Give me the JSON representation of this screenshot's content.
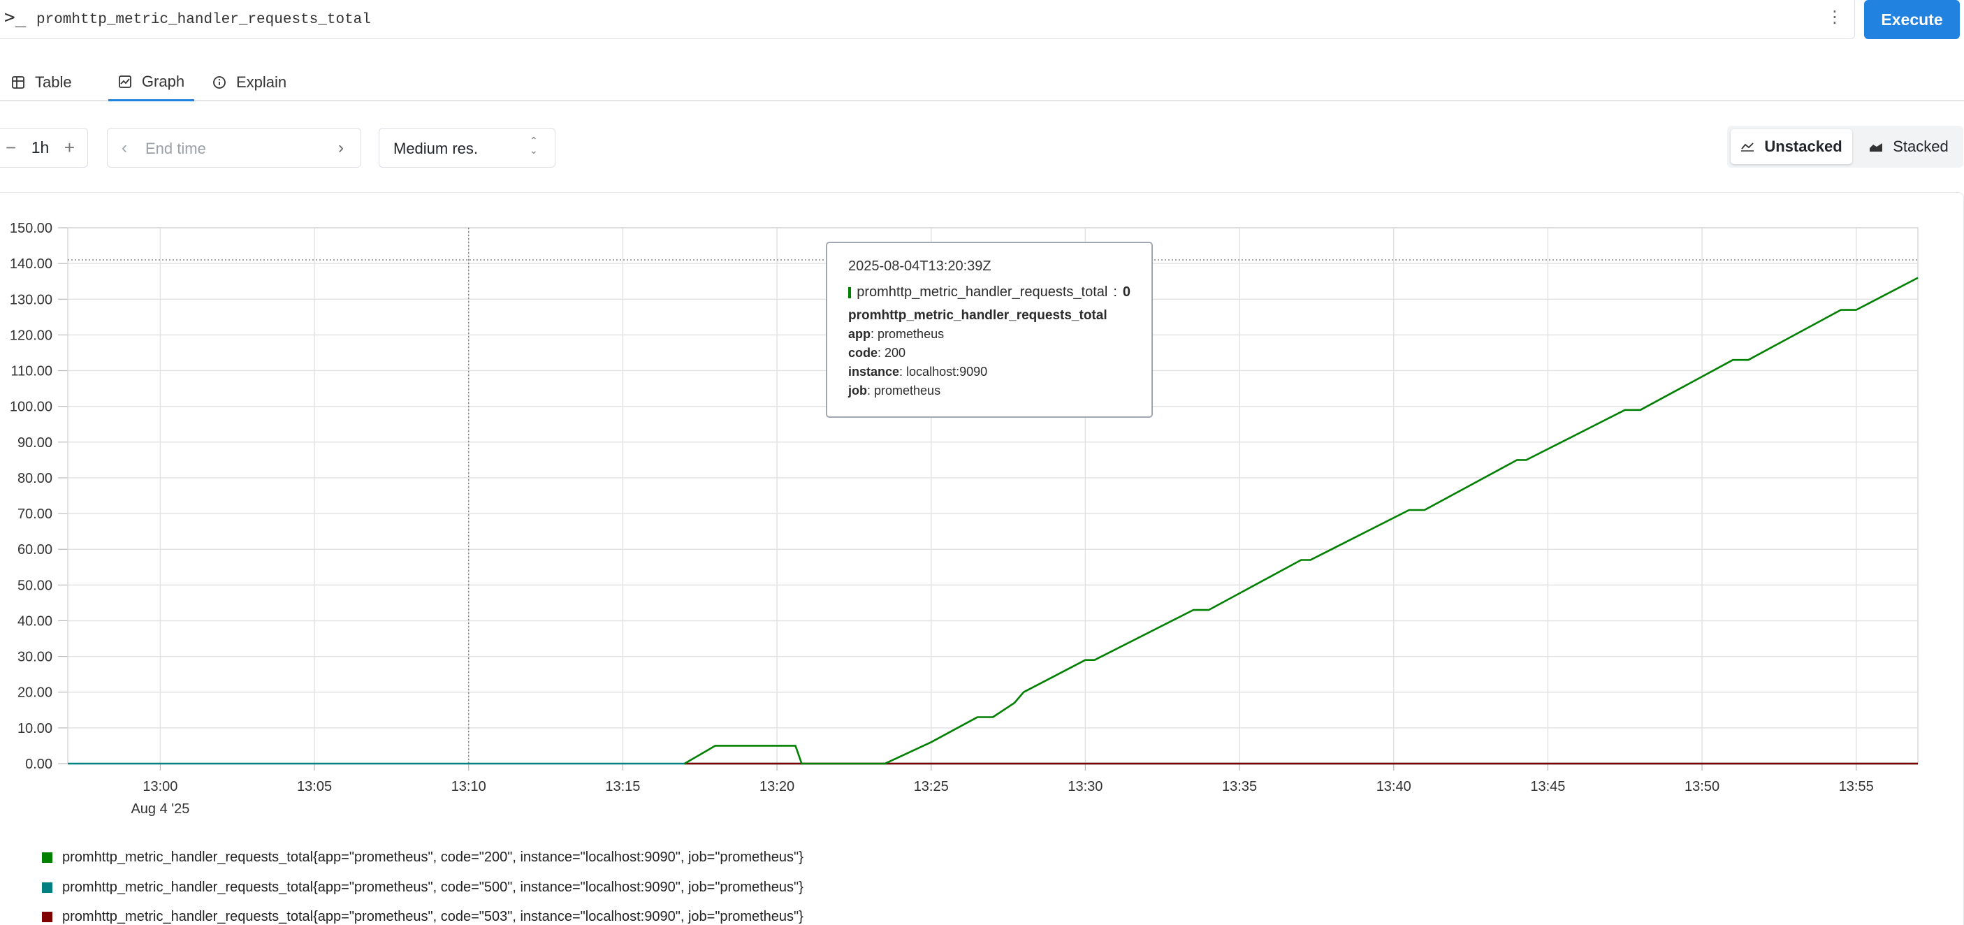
{
  "query": {
    "prompt_icon": "terminal-prompt-icon",
    "expression": "promhttp_metric_handler_requests_total",
    "menu_icon": "kebab-icon",
    "execute_label": "Execute"
  },
  "tabs": [
    {
      "label": "Table",
      "icon": "table-icon"
    },
    {
      "label": "Graph",
      "icon": "graph-icon",
      "active": true
    },
    {
      "label": "Explain",
      "icon": "info-icon"
    }
  ],
  "controls": {
    "range": "1h",
    "endtime_placeholder": "End time",
    "resolution": "Medium res.",
    "unstacked_label": "Unstacked",
    "stacked_label": "Stacked",
    "selected_mode": "Unstacked"
  },
  "tooltip": {
    "time": "2025-08-04T13:20:39Z",
    "series_name": "promhttp_metric_handler_requests_total",
    "value": "0",
    "metric_name": "promhttp_metric_handler_requests_total",
    "labels": [
      {
        "key": "app",
        "value": "prometheus"
      },
      {
        "key": "code",
        "value": "200"
      },
      {
        "key": "instance",
        "value": "localhost:9090"
      },
      {
        "key": "job",
        "value": "prometheus"
      }
    ]
  },
  "legend": [
    {
      "label": "promhttp_metric_handler_requests_total{app=\"prometheus\", code=\"200\", instance=\"localhost:9090\", job=\"prometheus\"}",
      "color": "#008000"
    },
    {
      "label": "promhttp_metric_handler_requests_total{app=\"prometheus\", code=\"500\", instance=\"localhost:9090\", job=\"prometheus\"}",
      "color": "#008080"
    },
    {
      "label": "promhttp_metric_handler_requests_total{app=\"prometheus\", code=\"503\", instance=\"localhost:9090\", job=\"prometheus\"}",
      "color": "#800000"
    }
  ],
  "chart_data": {
    "type": "line",
    "xlim": [
      "12:57",
      "13:57"
    ],
    "ylim": [
      0,
      150
    ],
    "grid": true,
    "x_ticks": [
      "13:00",
      "13:05",
      "13:10",
      "13:15",
      "13:20",
      "13:25",
      "13:30",
      "13:35",
      "13:40",
      "13:45",
      "13:50",
      "13:55"
    ],
    "x_sublabel": "Aug 4 '25",
    "y_ticks": [
      "0.00",
      "10.00",
      "20.00",
      "30.00",
      "40.00",
      "50.00",
      "60.00",
      "70.00",
      "80.00",
      "90.00",
      "100.00",
      "110.00",
      "120.00",
      "130.00",
      "140.00",
      "150.00"
    ],
    "cursor": {
      "x": "13:10",
      "y": 141
    },
    "series": [
      {
        "color": "#008000",
        "points": [
          [
            "13:17",
            0
          ],
          [
            "13:18",
            5
          ],
          [
            "13:20",
            5
          ],
          [
            "13:20.6",
            5
          ],
          [
            "13:20.8",
            0
          ],
          [
            "13:23.5",
            0
          ],
          [
            "13:24",
            2
          ],
          [
            "13:25",
            6
          ],
          [
            "13:26.5",
            13
          ],
          [
            "13:27",
            13
          ],
          [
            "13:27.7",
            17
          ],
          [
            "13:28",
            20
          ],
          [
            "13:30",
            29
          ],
          [
            "13:30.3",
            29
          ],
          [
            "13:33.5",
            43
          ],
          [
            "13:34",
            43
          ],
          [
            "13:37",
            57
          ],
          [
            "13:37.3",
            57
          ],
          [
            "13:40.5",
            71
          ],
          [
            "13:41",
            71
          ],
          [
            "13:44",
            85
          ],
          [
            "13:44.3",
            85
          ],
          [
            "13:47.5",
            99
          ],
          [
            "13:48",
            99
          ],
          [
            "13:51",
            113
          ],
          [
            "13:51.5",
            113
          ],
          [
            "13:54.5",
            127
          ],
          [
            "13:55",
            127
          ],
          [
            "13:57",
            136
          ]
        ]
      },
      {
        "color": "#008080",
        "points": [
          [
            "12:57",
            0
          ],
          [
            "13:57",
            0
          ]
        ]
      },
      {
        "color": "#800000",
        "points": [
          [
            "13:17",
            0
          ],
          [
            "13:57",
            0
          ]
        ]
      }
    ]
  }
}
